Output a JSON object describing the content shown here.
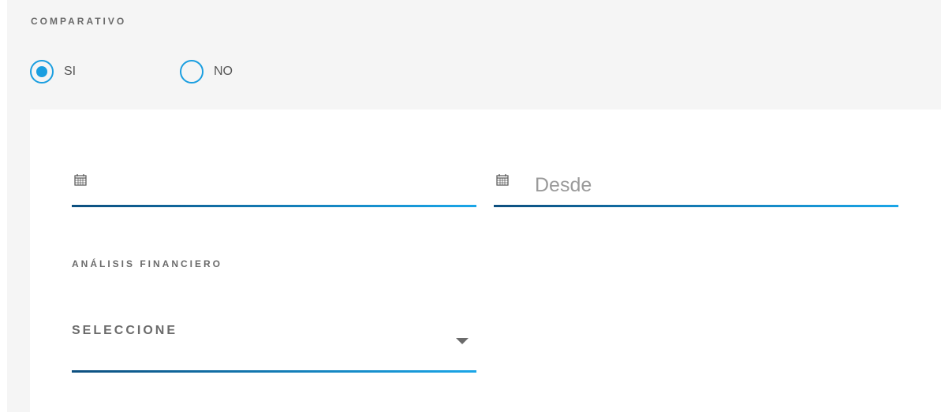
{
  "comparativo": {
    "label": "COMPARATIVO",
    "options": [
      {
        "label": "SI",
        "selected": true
      },
      {
        "label": "NO",
        "selected": false
      }
    ]
  },
  "dates": {
    "first": {
      "value": "",
      "icon": "calendar-icon"
    },
    "second": {
      "placeholder": "Desde",
      "icon": "calendar-icon"
    }
  },
  "analisis": {
    "label": "ANÁLISIS FINANCIERO",
    "select_value": "SELECCIONE"
  },
  "colors": {
    "accent": "#1a9ee0",
    "underline_start": "#0d4f7f",
    "underline_end": "#1aa6e8"
  }
}
